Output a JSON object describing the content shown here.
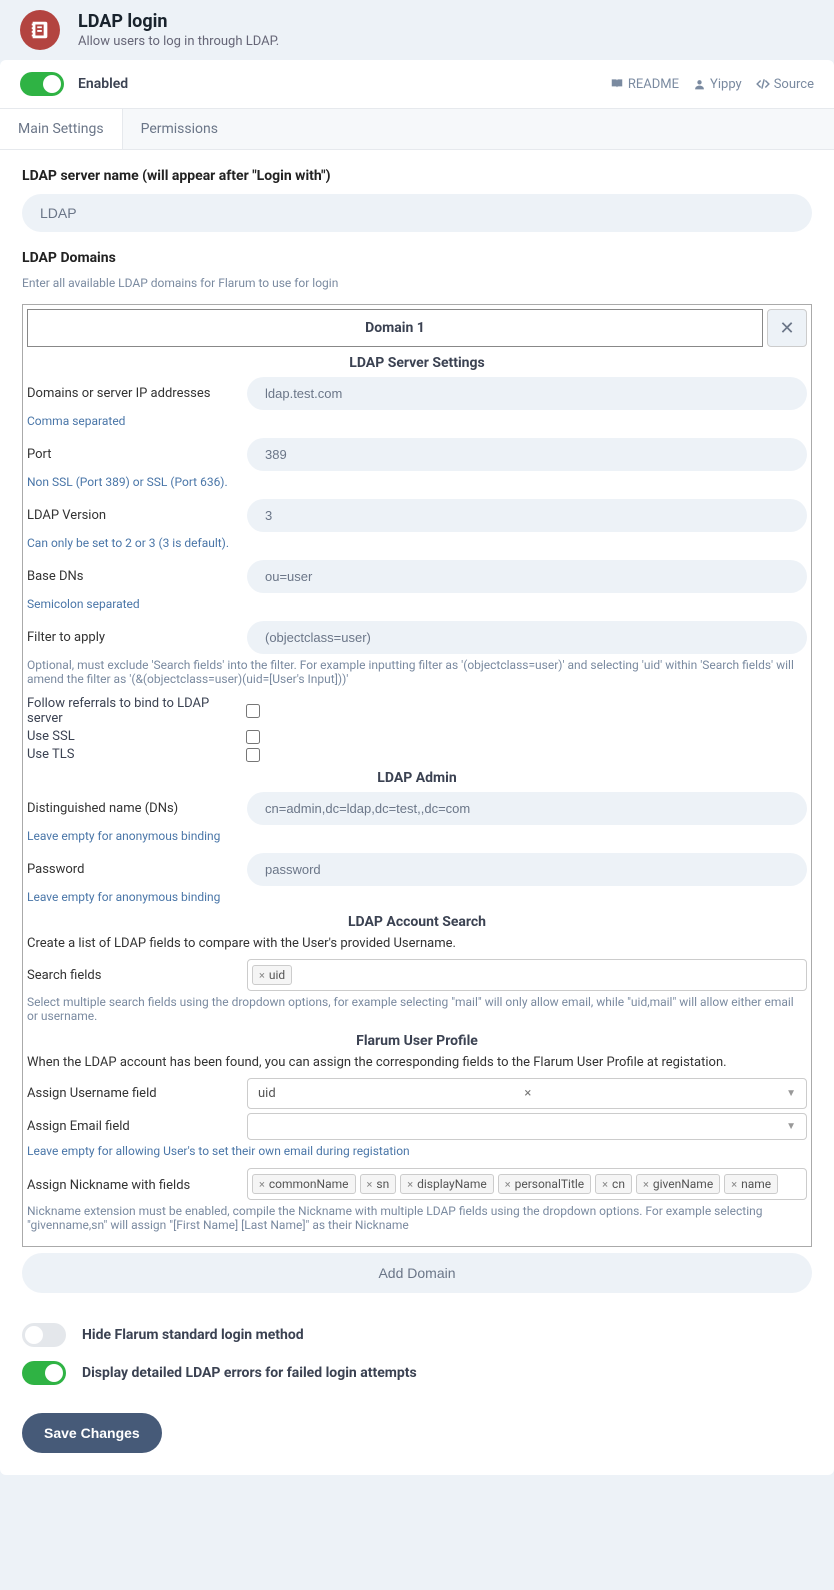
{
  "header": {
    "title": "LDAP login",
    "subtitle": "Allow users to log in through LDAP."
  },
  "topbar": {
    "enabled_label": "Enabled",
    "readme": "README",
    "author": "Yippy",
    "source": "Source"
  },
  "tabs": {
    "main": "Main Settings",
    "permissions": "Permissions"
  },
  "server_name": {
    "label": "LDAP server name (will appear after \"Login with\")",
    "value": "LDAP"
  },
  "domains_section": {
    "label": "LDAP Domains",
    "hint": "Enter all available LDAP domains for Flarum to use for login"
  },
  "domain": {
    "title": "Domain 1",
    "server_settings_head": "LDAP Server Settings",
    "domains_label": "Domains or server IP addresses",
    "domains_value": "ldap.test.com",
    "domains_hint": "Comma separated",
    "port_label": "Port",
    "port_value": "389",
    "port_hint": "Non SSL (Port 389) or SSL (Port 636).",
    "version_label": "LDAP Version",
    "version_value": "3",
    "version_hint": "Can only be set to 2 or 3 (3 is default).",
    "base_label": "Base DNs",
    "base_value": "ou=user",
    "base_hint": "Semicolon separated",
    "filter_label": "Filter to apply",
    "filter_value": "(objectclass=user)",
    "filter_hint": "Optional, must exclude 'Search fields' into the filter. For example inputting filter as '(objectclass=user)' and selecting 'uid' within 'Search fields' will amend the filter as '(&(objectclass=user)(uid=[User's Input]))'",
    "follow_label": "Follow referrals to bind to LDAP server",
    "ssl_label": "Use SSL",
    "tls_label": "Use TLS",
    "admin_head": "LDAP Admin",
    "dn_label": "Distinguished name (DNs)",
    "dn_value": "cn=admin,dc=ldap,dc=test,,dc=com",
    "dn_hint": "Leave empty for anonymous binding",
    "password_label": "Password",
    "password_value": "password",
    "password_hint": "Leave empty for anonymous binding",
    "search_head": "LDAP Account Search",
    "search_desc": "Create a list of LDAP fields to compare with the User's provided Username.",
    "search_label": "Search fields",
    "search_tags": [
      "uid"
    ],
    "search_hint": "Select multiple search fields using the dropdown options, for example selecting \"mail\" will only allow email, while \"uid,mail\" will allow either email or username.",
    "profile_head": "Flarum User Profile",
    "profile_desc": "When the LDAP account has been found, you can assign the corresponding fields to the Flarum User Profile at registation.",
    "username_label": "Assign Username field",
    "username_value": "uid",
    "email_label": "Assign Email field",
    "email_hint": "Leave empty for allowing User's to set their own email during registation",
    "nickname_label": "Assign Nickname with fields",
    "nickname_tags": [
      "commonName",
      "sn",
      "displayName",
      "personalTitle",
      "cn",
      "givenName",
      "name"
    ],
    "nickname_hint": "Nickname extension must be enabled, compile the Nickname with multiple LDAP fields using the dropdown options. For example selecting \"givenname,sn\" will assign \"[First Name] [Last Name]\" as their Nickname"
  },
  "add_domain": "Add Domain",
  "toggles": {
    "hide_login": "Hide Flarum standard login method",
    "display_errors": "Display detailed LDAP errors for failed login attempts"
  },
  "save": "Save Changes"
}
